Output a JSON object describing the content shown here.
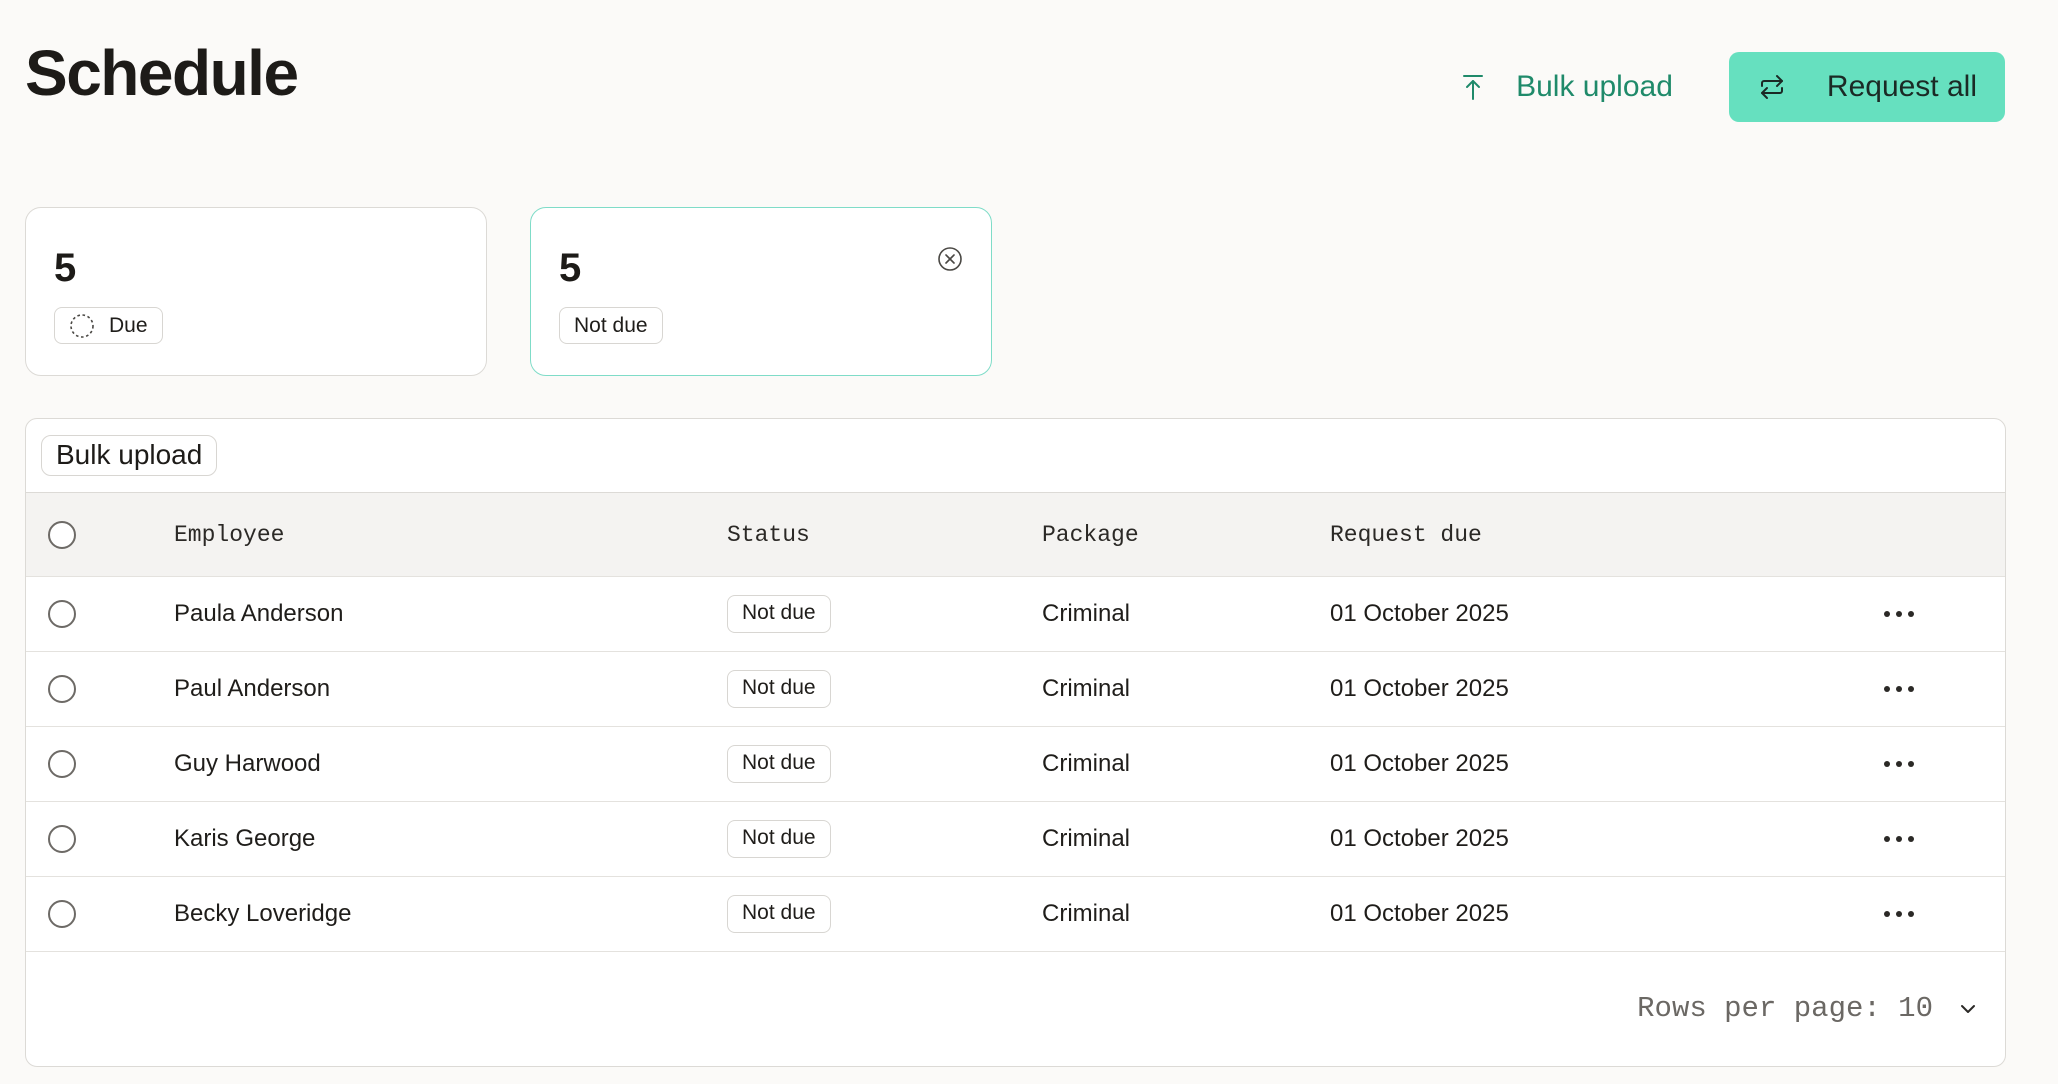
{
  "header": {
    "title": "Schedule",
    "bulk_upload_label": "Bulk upload",
    "request_all_label": "Request all"
  },
  "summary_cards": [
    {
      "count": "5",
      "label": "Due",
      "icon": "dashed-circle-icon",
      "active": false
    },
    {
      "count": "5",
      "label": "Not due",
      "icon": "close-circle-icon",
      "active": true
    }
  ],
  "toolbar": {
    "bulk_upload_label": "Bulk upload"
  },
  "table": {
    "columns": [
      "Employee",
      "Status",
      "Package",
      "Request due"
    ],
    "rows": [
      {
        "employee": "Paula Anderson",
        "status": "Not due",
        "package": "Criminal",
        "request_due": "01 October 2025"
      },
      {
        "employee": "Paul Anderson",
        "status": "Not due",
        "package": "Criminal",
        "request_due": "01 October 2025"
      },
      {
        "employee": "Guy Harwood",
        "status": "Not due",
        "package": "Criminal",
        "request_due": "01 October 2025"
      },
      {
        "employee": "Karis George",
        "status": "Not due",
        "package": "Criminal",
        "request_due": "01 October 2025"
      },
      {
        "employee": "Becky Loveridge",
        "status": "Not due",
        "package": "Criminal",
        "request_due": "01 October 2025"
      }
    ]
  },
  "pagination": {
    "rows_per_page_label": "Rows per page: 10"
  },
  "colors": {
    "accent": "#66e0bf",
    "accent_text": "#1f8a6a",
    "active_card_border": "#7fdcc8"
  }
}
